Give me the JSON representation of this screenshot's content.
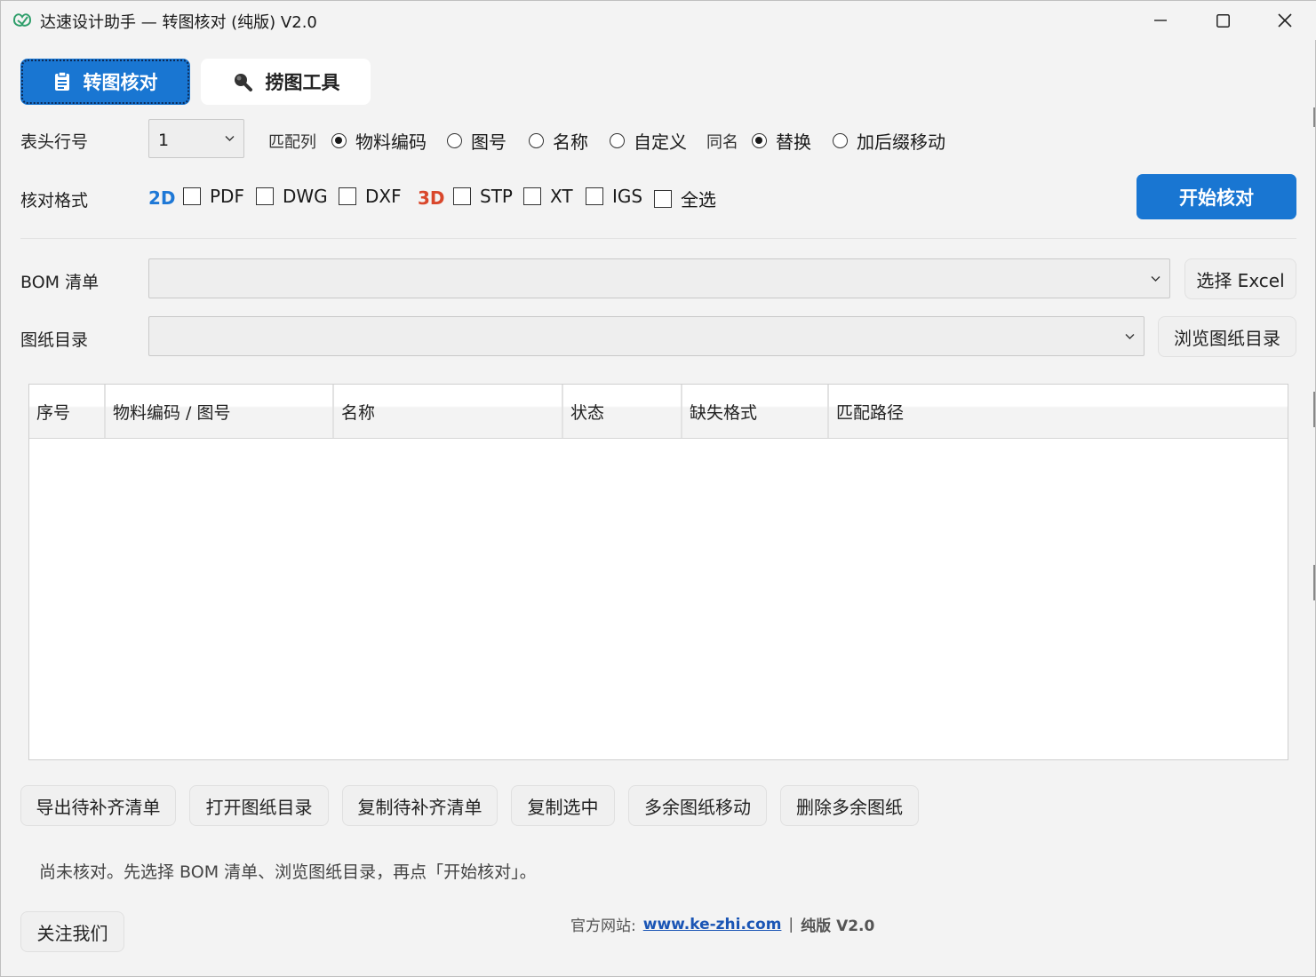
{
  "window": {
    "title": "达速设计助手 — 转图核对 (纯版) V2.0",
    "icon": "leaf-app-icon"
  },
  "tabs": [
    {
      "label": "转图核对",
      "icon": "clipboard-icon",
      "active": true
    },
    {
      "label": "捞图工具",
      "icon": "search-icon",
      "active": false
    }
  ],
  "header_row": {
    "label": "表头行号",
    "value": "1"
  },
  "match_col": {
    "label": "匹配列",
    "options": [
      "物料编码",
      "图号",
      "名称",
      "自定义"
    ],
    "selected": "物料编码"
  },
  "same_name": {
    "label": "同名",
    "options": [
      "替换",
      "加后缀移动"
    ],
    "selected": "替换"
  },
  "check_format": {
    "label": "核对格式",
    "tag_2d": "2D",
    "formats_2d": [
      "PDF",
      "DWG",
      "DXF"
    ],
    "tag_3d": "3D",
    "formats_3d": [
      "STP",
      "XT",
      "IGS"
    ],
    "select_all": "全选",
    "colors": {
      "2d": "#1e78d6",
      "3d": "#d9472b"
    }
  },
  "start_button": "开始核对",
  "bom": {
    "label": "BOM 清单",
    "value": "",
    "button": "选择 Excel"
  },
  "drawing_dir": {
    "label": "图纸目录",
    "value": "",
    "button": "浏览图纸目录"
  },
  "table": {
    "columns": [
      "序号",
      "物料编码 / 图号",
      "名称",
      "状态",
      "缺失格式",
      "匹配路径"
    ],
    "rows": []
  },
  "actions": [
    "导出待补齐清单",
    "打开图纸目录",
    "复制待补齐清单",
    "复制选中",
    "多余图纸移动",
    "删除多余图纸"
  ],
  "status_text": "尚未核对。先选择 BOM 清单、浏览图纸目录，再点「开始核对」。",
  "follow_button": "关注我们",
  "footer": {
    "site_label": "官方网站:",
    "site_link": "www.ke-zhi.com",
    "separator": "|",
    "edition": "纯版 V2.0"
  },
  "accent_color": "#1976d2"
}
